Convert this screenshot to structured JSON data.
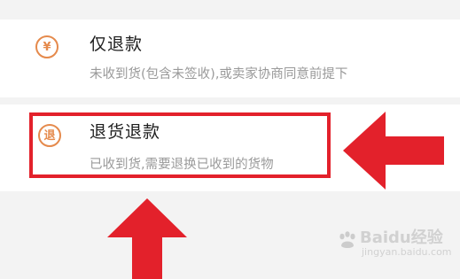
{
  "refund_options": [
    {
      "icon": "yen-return-icon",
      "icon_glyph": "¥",
      "title": "仅退款",
      "description": "未收到货(包含未签收),或卖家协商同意前提下"
    },
    {
      "icon": "return-goods-icon",
      "icon_glyph": "退",
      "title": "退货退款",
      "description": "已收到货,需要退换已收到的货物"
    }
  ],
  "annotations": {
    "highlight_color": "#e3212b",
    "arrow_color": "#e3212b"
  },
  "watermark": {
    "brand": "Baidu经验",
    "url": "jingyan.baidu.com"
  },
  "colors": {
    "accent": "#e58a4c",
    "title_text": "#1f1f1f",
    "description_text": "#9a9a9a",
    "background": "#f3f3f3"
  }
}
